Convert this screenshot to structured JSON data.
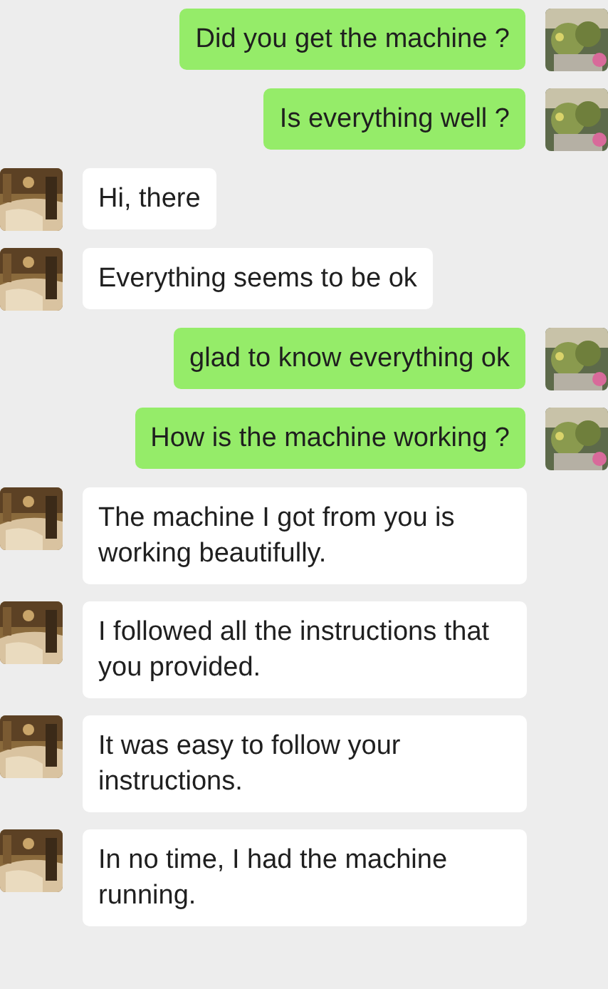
{
  "messages": [
    {
      "kind": "sent",
      "text": "Did you get the machine ?"
    },
    {
      "kind": "sent",
      "text": "Is everything well ?"
    },
    {
      "kind": "received",
      "text": "Hi, there"
    },
    {
      "kind": "received",
      "text": "Everything seems to be ok"
    },
    {
      "kind": "sent",
      "text": "glad to know everything ok"
    },
    {
      "kind": "sent",
      "text": "How is the machine working ?"
    },
    {
      "kind": "received",
      "text": "The machine I got from you is working beautifully."
    },
    {
      "kind": "received",
      "text": "I followed all the  instructions that you provided."
    },
    {
      "kind": "received",
      "text": "It was easy to  follow your instructions."
    },
    {
      "kind": "received",
      "text": "In no time, I had the machine running."
    }
  ]
}
